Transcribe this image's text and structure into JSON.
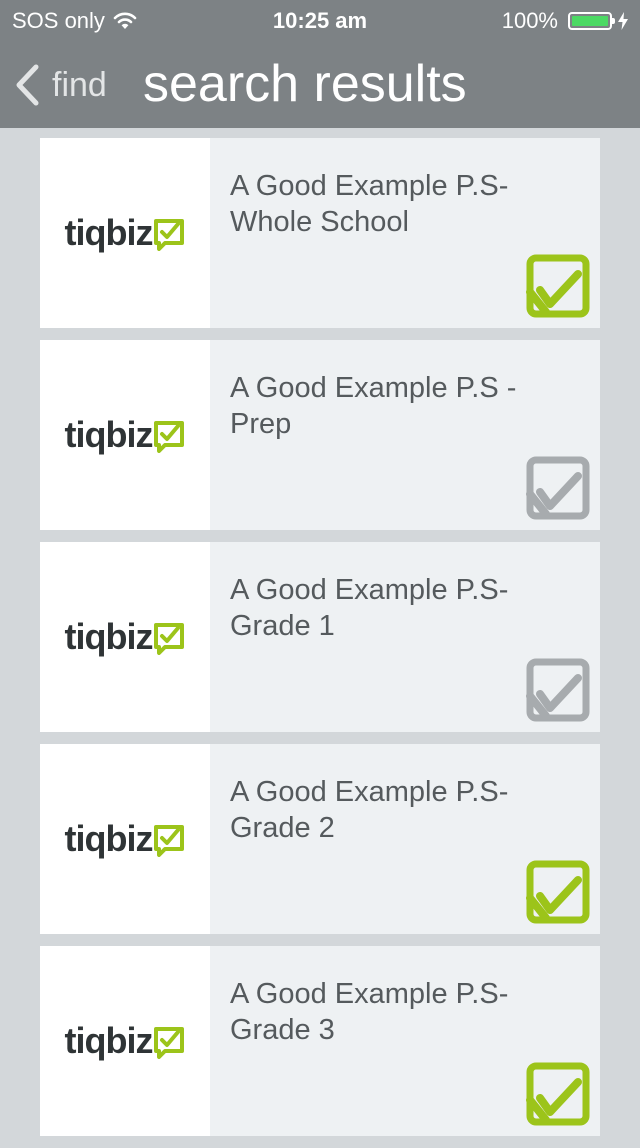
{
  "status_bar": {
    "carrier": "SOS only",
    "time": "10:25 am",
    "battery_percent": "100%",
    "battery_level": 1.0,
    "battery_color": "#4cd964"
  },
  "nav": {
    "back_label": "find",
    "title": "search results"
  },
  "colors": {
    "subscribed": "#9cc41a",
    "unsubscribed": "#a7abae",
    "navbar": "#7d8285"
  },
  "results": [
    {
      "logo_text": "tiqbiz",
      "name": "A Good Example P.S- Whole School",
      "subscribed": true
    },
    {
      "logo_text": "tiqbiz",
      "name": "A Good Example P.S - Prep",
      "subscribed": false
    },
    {
      "logo_text": "tiqbiz",
      "name": "A Good Example P.S- Grade 1",
      "subscribed": false
    },
    {
      "logo_text": "tiqbiz",
      "name": "A Good Example P.S- Grade 2",
      "subscribed": true
    },
    {
      "logo_text": "tiqbiz",
      "name": "A Good Example P.S- Grade 3",
      "subscribed": true
    }
  ]
}
